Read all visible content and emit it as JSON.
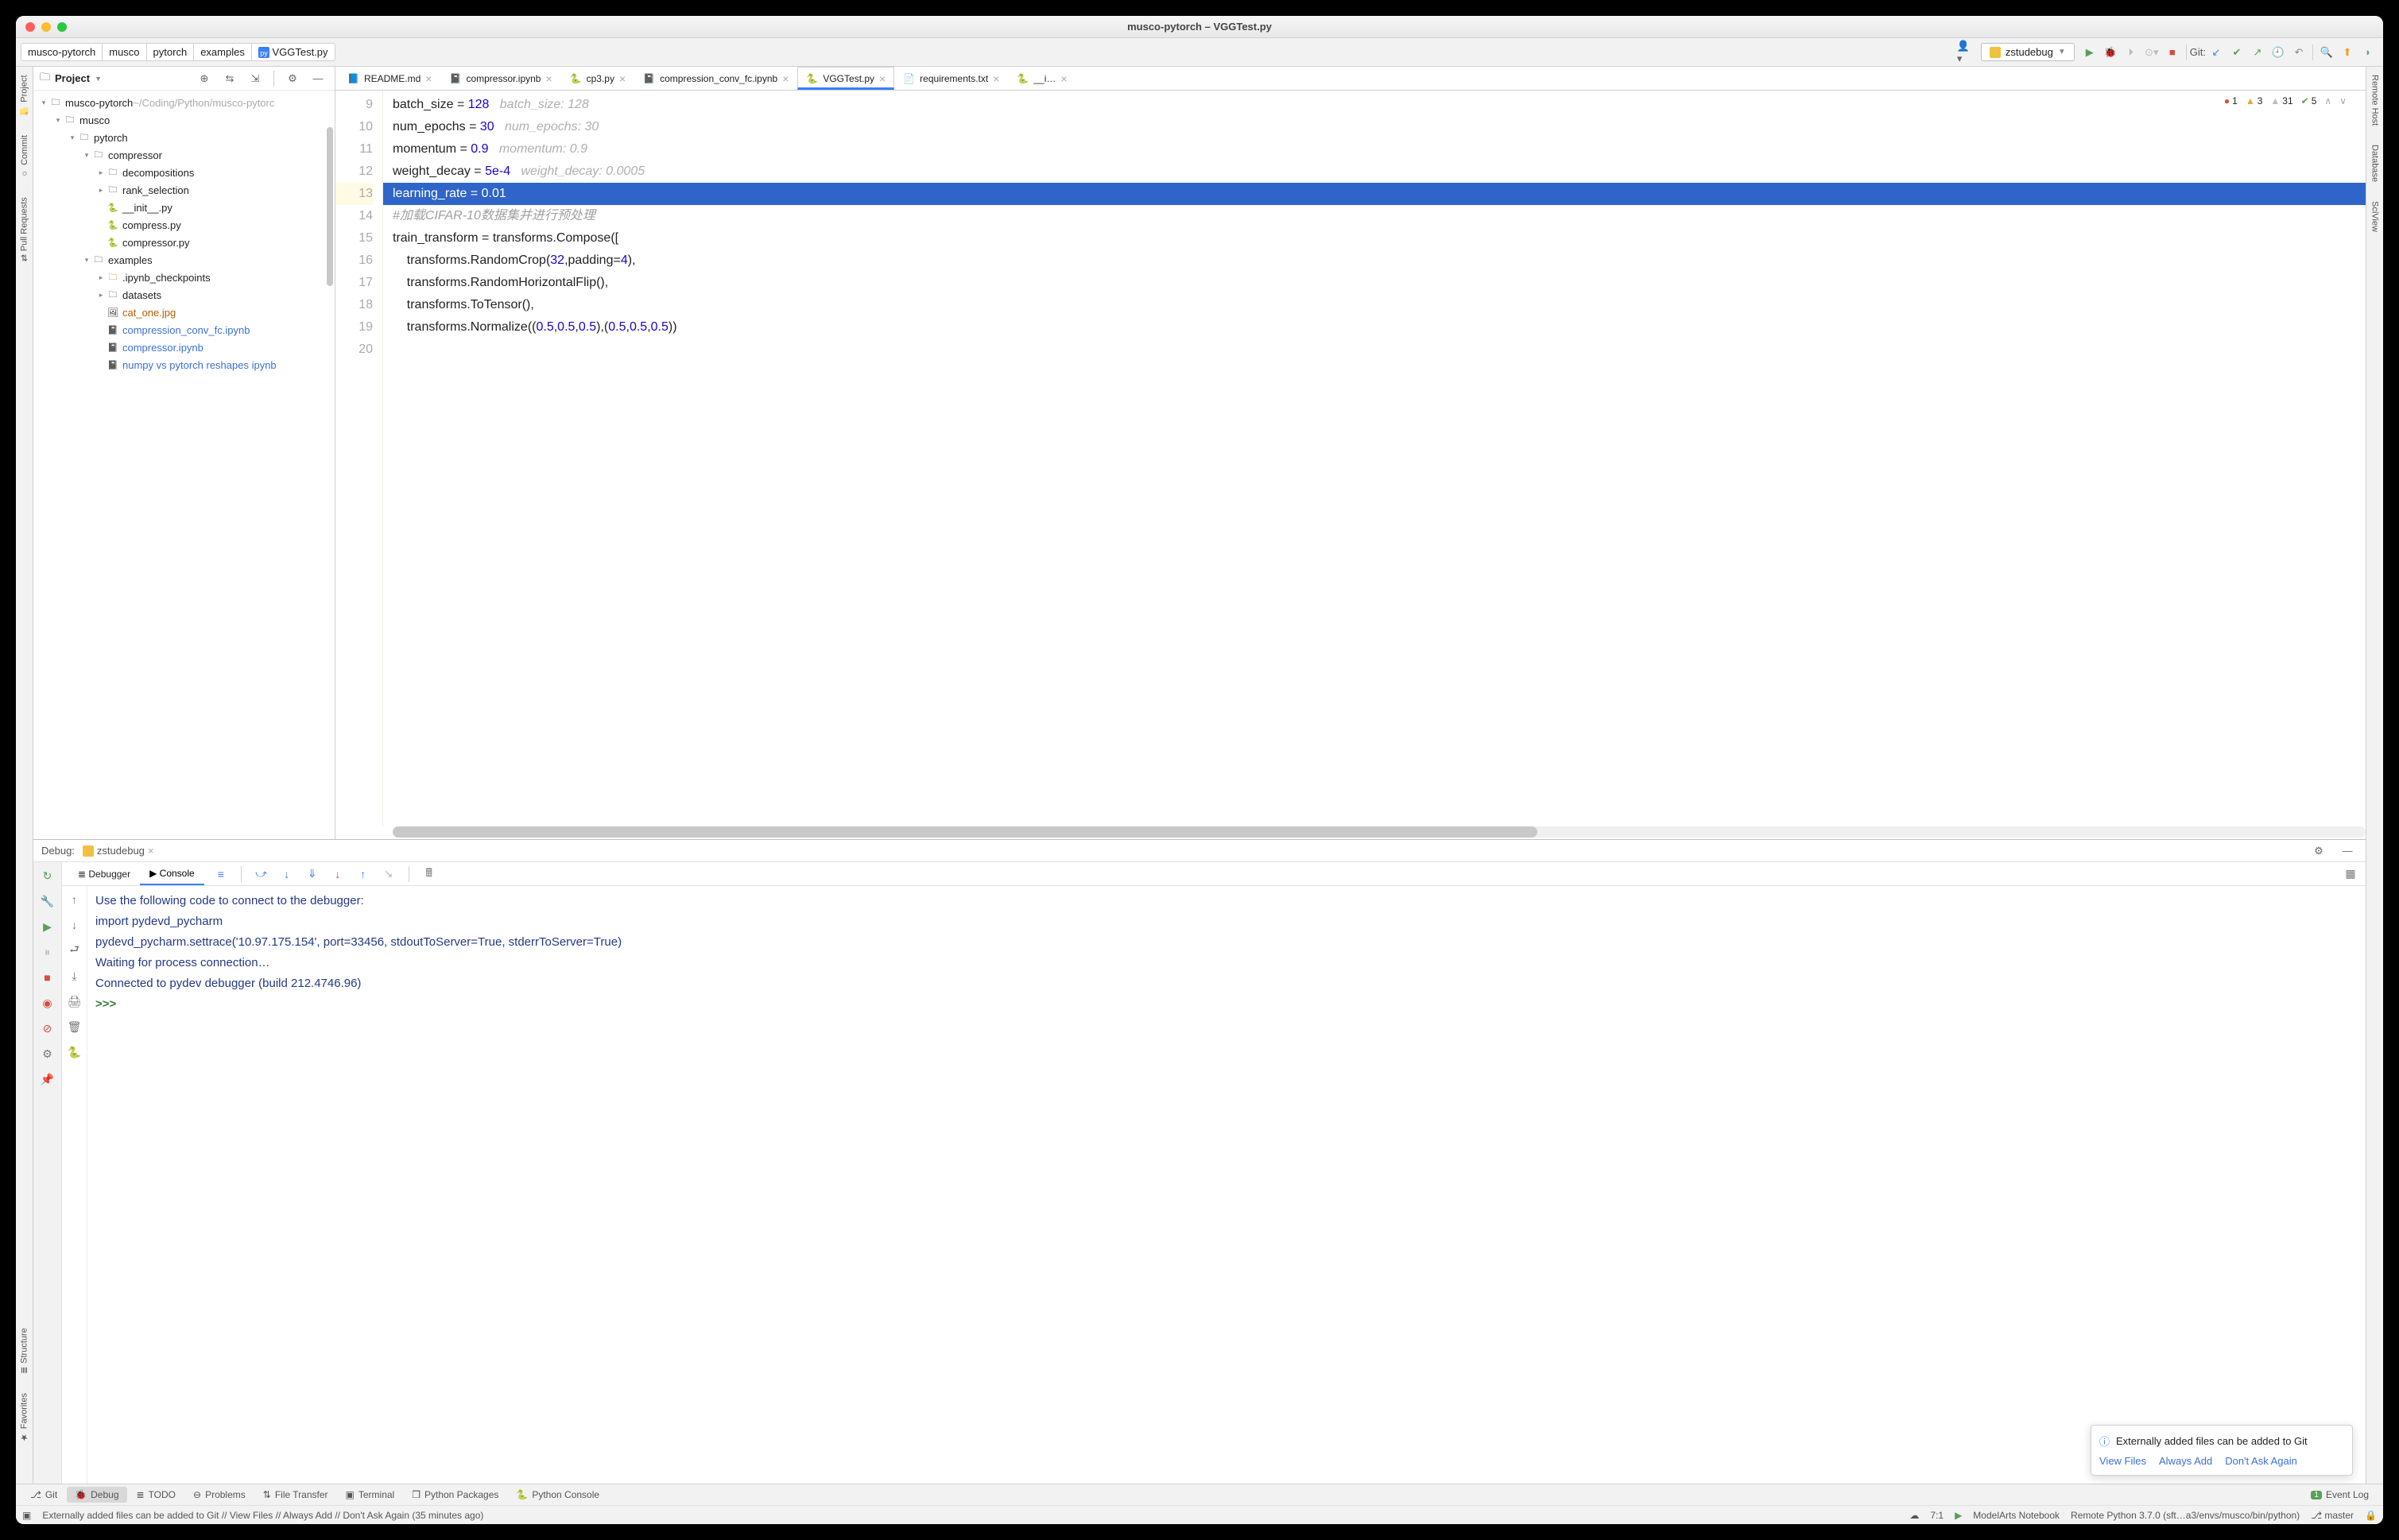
{
  "titlebar": {
    "title": "musco-pytorch – VGGTest.py"
  },
  "breadcrumbs": [
    "musco-pytorch",
    "musco",
    "pytorch",
    "examples",
    "VGGTest.py"
  ],
  "runconfig": {
    "label": "zstudebug"
  },
  "git_label": "Git:",
  "leftSidebar": [
    "Project",
    "Commit",
    "Pull Requests"
  ],
  "leftSidebar2": [
    "Structure",
    "Favorites"
  ],
  "rightSidebar": [
    "Remote Host",
    "Database",
    "SciView"
  ],
  "project": {
    "header": "Project",
    "root": {
      "label": "musco-pytorch",
      "path": "~/Coding/Python/musco-pytorc"
    },
    "tree": [
      {
        "depth": 0,
        "open": true,
        "type": "dir",
        "label": "musco-pytorch",
        "dim_suffix": "~/Coding/Python/musco-pytorc"
      },
      {
        "depth": 1,
        "open": true,
        "type": "dir",
        "label": "musco"
      },
      {
        "depth": 2,
        "open": true,
        "type": "dir-src",
        "label": "pytorch"
      },
      {
        "depth": 3,
        "open": true,
        "type": "dir-src",
        "label": "compressor"
      },
      {
        "depth": 4,
        "open": false,
        "type": "dir-src",
        "label": "decompositions"
      },
      {
        "depth": 4,
        "open": false,
        "type": "dir-src",
        "label": "rank_selection"
      },
      {
        "depth": 4,
        "type": "py",
        "label": "__init__.py"
      },
      {
        "depth": 4,
        "type": "py",
        "label": "compress.py"
      },
      {
        "depth": 4,
        "type": "py",
        "label": "compressor.py"
      },
      {
        "depth": 3,
        "open": true,
        "type": "dir",
        "label": "examples"
      },
      {
        "depth": 4,
        "open": false,
        "type": "dir-warn",
        "label": ".ipynb_checkpoints"
      },
      {
        "depth": 4,
        "open": false,
        "type": "dir",
        "label": "datasets"
      },
      {
        "depth": 4,
        "type": "img",
        "label": "cat_one.jpg",
        "warn": true
      },
      {
        "depth": 4,
        "type": "ipynb",
        "label": "compression_conv_fc.ipynb",
        "link": true
      },
      {
        "depth": 4,
        "type": "ipynb",
        "label": "compressor.ipynb",
        "link": true
      },
      {
        "depth": 4,
        "type": "ipynb",
        "label": "numpy vs pytorch reshapes ipynb",
        "link": true
      }
    ]
  },
  "tabs": [
    {
      "icon": "md",
      "label": "README.md",
      "active": false
    },
    {
      "icon": "ipynb",
      "label": "compressor.ipynb",
      "active": false
    },
    {
      "icon": "py",
      "label": "cp3.py",
      "active": false
    },
    {
      "icon": "ipynb",
      "label": "compression_conv_fc.ipynb",
      "active": false
    },
    {
      "icon": "py",
      "label": "VGGTest.py",
      "active": true
    },
    {
      "icon": "txt",
      "label": "requirements.txt",
      "active": false
    },
    {
      "icon": "py",
      "label": "__i…",
      "active": false
    }
  ],
  "inspections": {
    "errors": "1",
    "warnings": "3",
    "weak": "31",
    "ok": "5"
  },
  "editor": {
    "lines": [
      {
        "n": 9,
        "text": "batch_size = ",
        "num": "128",
        "hint": "   batch_size: 128"
      },
      {
        "n": 10,
        "text": "num_epochs = ",
        "num": "30",
        "hint": "   num_epochs: 30"
      },
      {
        "n": 11,
        "text": "momentum = ",
        "num": "0.9",
        "hint": "   momentum: 0.9"
      },
      {
        "n": 12,
        "text": "weight_decay = ",
        "num": "5e-4",
        "hint": "   weight_decay: 0.0005"
      },
      {
        "n": 13,
        "sel": true,
        "text": "learning_rate = ",
        "num": "0.01",
        "hint": ""
      },
      {
        "n": 14,
        "cmt": "#加载CIFAR-10数据集并进行预处理"
      },
      {
        "n": 15,
        "raw": "train_transform = transforms.Compose(["
      },
      {
        "n": 16,
        "raw": "    transforms.RandomCrop(",
        "nums": [
          "32"
        ],
        "tail": ",padding=",
        "nums2": [
          "4"
        ],
        "close": "),"
      },
      {
        "n": 17,
        "raw": "    transforms.RandomHorizontalFlip(),"
      },
      {
        "n": 18,
        "raw": "    transforms.ToTensor(),"
      },
      {
        "n": 19,
        "norm": true
      },
      {
        "n": 20,
        "raw": ""
      }
    ],
    "norm_line": {
      "prefix": "    transforms.Normalize((",
      "vals": [
        "0.5",
        "0.5",
        "0.5"
      ],
      "mid": "),(",
      "vals2": [
        "0.5",
        "0.5",
        "0.5"
      ],
      "suffix": "))"
    }
  },
  "debug": {
    "label": "Debug:",
    "config": "zstudebug",
    "tabs": {
      "debugger": "Debugger",
      "console": "Console"
    },
    "console_lines": [
      {
        "cls": "cb",
        "text": "Use the following code to connect to the debugger:"
      },
      {
        "cls": "cb",
        "text": "import pydevd_pycharm"
      },
      {
        "cls": "cb",
        "text": "pydevd_pycharm.settrace('10.97.175.154', port=33456, stdoutToServer=True, stderrToServer=True)"
      },
      {
        "cls": "cb",
        "text": "Waiting for process connection…"
      },
      {
        "cls": "cb",
        "text": "Connected to pydev debugger (build 212.4746.96)"
      },
      {
        "cls": "",
        "text": ""
      },
      {
        "cls": "cg",
        "text": ">>> "
      }
    ]
  },
  "notification": {
    "title": "Externally added files can be added to Git",
    "actions": [
      "View Files",
      "Always Add",
      "Don't Ask Again"
    ]
  },
  "toolwindows": [
    "Git",
    "Debug",
    "TODO",
    "Problems",
    "File Transfer",
    "Terminal",
    "Python Packages",
    "Python Console"
  ],
  "toolwindows_right": "Event Log",
  "statusbar": {
    "msg": "Externally added files can be added to Git // View Files // Always Add // Don't Ask Again (35 minutes ago)",
    "pos": "7:1",
    "notebook": "ModelArts Notebook",
    "interpreter": "Remote Python 3.7.0 (sft…a3/envs/musco/bin/python)",
    "branch": "master"
  }
}
